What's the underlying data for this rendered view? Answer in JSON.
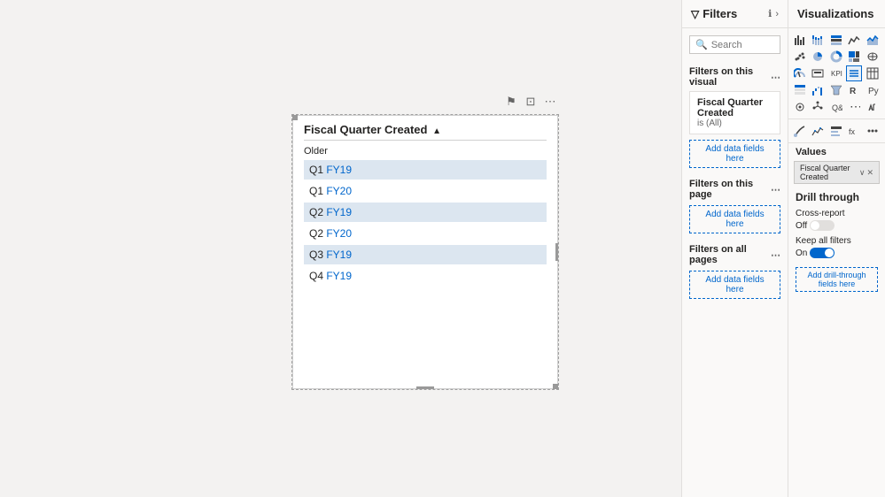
{
  "canvas": {
    "background": "#f3f2f1"
  },
  "visual": {
    "title": "Fiscal Quarter Created",
    "sort_indicator": "▲",
    "older_label": "Older",
    "items": [
      {
        "prefix": "Q1 ",
        "suffix": "FY19",
        "highlighted": true
      },
      {
        "prefix": "Q1 ",
        "suffix": "FY20",
        "highlighted": false
      },
      {
        "prefix": "Q2 ",
        "suffix": "FY19",
        "highlighted": true
      },
      {
        "prefix": "Q2 ",
        "suffix": "FY20",
        "highlighted": false
      },
      {
        "prefix": "Q3 ",
        "suffix": "FY19",
        "highlighted": true
      },
      {
        "prefix": "Q4 ",
        "suffix": "FY19",
        "highlighted": false
      }
    ],
    "toolbar": {
      "filter_icon": "⚑",
      "focus_icon": "⊡",
      "more_icon": "⋯"
    }
  },
  "filters_panel": {
    "title": "Filters",
    "search_placeholder": "Search",
    "sections": {
      "this_visual": {
        "label": "Filters on this visual",
        "card_title": "Fiscal Quarter Created",
        "card_value": "is (All)",
        "add_button": "Add data fields here"
      },
      "this_page": {
        "label": "Filters on this page",
        "add_button": "Add data fields here"
      },
      "all_pages": {
        "label": "Filters on all pages",
        "add_button": "Add data fields here"
      }
    }
  },
  "viz_panel": {
    "title": "Visualizations",
    "values_label": "Values",
    "field_chip_label": "Fiscal Quarter Created",
    "drill_through": {
      "title": "Drill through",
      "cross_report_label": "Cross-report",
      "cross_report_state": "Off",
      "keep_filters_label": "Keep all filters",
      "keep_filters_state": "On",
      "add_button": "Add drill-through fields here"
    }
  }
}
